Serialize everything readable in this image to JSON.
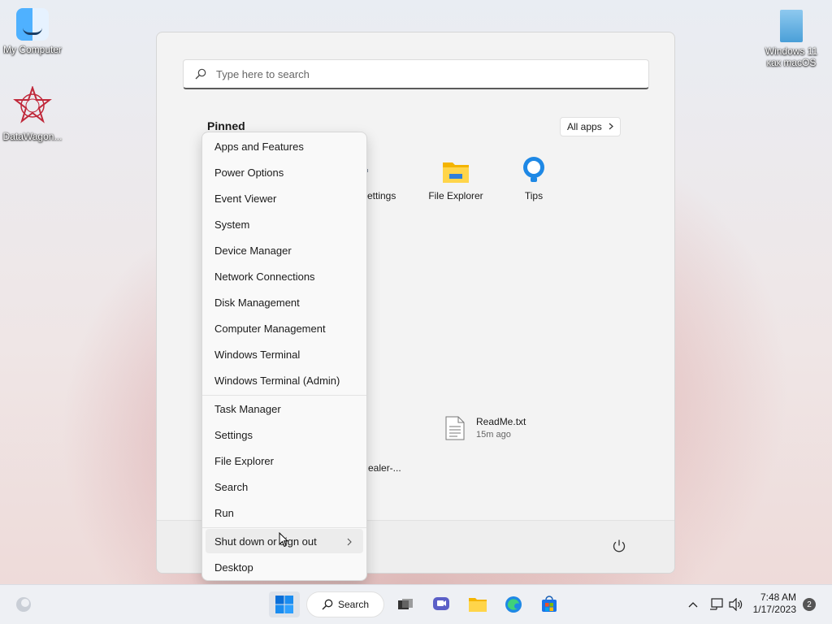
{
  "desktop": {
    "icons": [
      {
        "label": "My Computer"
      },
      {
        "label": "DataWagon..."
      },
      {
        "label": "Windows 11\nкак macOS"
      }
    ]
  },
  "start_menu": {
    "search_placeholder": "Type here to search",
    "pinned_label": "Pinned",
    "all_apps_label": "All apps",
    "pinned_apps": [
      {
        "label": "ettings",
        "icon": "settings-icon"
      },
      {
        "label": "File Explorer",
        "icon": "folder-icon"
      },
      {
        "label": "Tips",
        "icon": "tips-icon"
      }
    ],
    "recommended": [
      {
        "name": "ReadMe.txt",
        "time": "15m ago",
        "icon": "text-file-icon"
      }
    ],
    "clipped_label": "ealer-..."
  },
  "context_menu": {
    "items": [
      {
        "label": "Apps and Features"
      },
      {
        "label": "Power Options"
      },
      {
        "label": "Event Viewer"
      },
      {
        "label": "System"
      },
      {
        "label": "Device Manager"
      },
      {
        "label": "Network Connections"
      },
      {
        "label": "Disk Management"
      },
      {
        "label": "Computer Management"
      },
      {
        "label": "Windows Terminal"
      },
      {
        "label": "Windows Terminal (Admin)"
      },
      {
        "label": "Task Manager"
      },
      {
        "label": "Settings"
      },
      {
        "label": "File Explorer"
      },
      {
        "label": "Search"
      },
      {
        "label": "Run"
      },
      {
        "label": "Shut down or sign out",
        "submenu": true,
        "hovered": true
      },
      {
        "label": "Desktop"
      }
    ]
  },
  "taskbar": {
    "search_label": "Search",
    "time": "7:48 AM",
    "date": "1/17/2023",
    "notification_count": "2",
    "accent": "#0a6fd8"
  }
}
